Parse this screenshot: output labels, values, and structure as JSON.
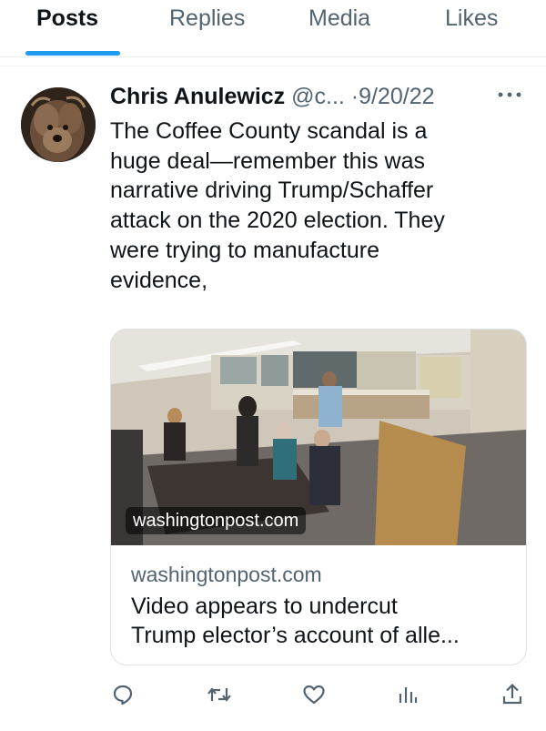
{
  "tabs": [
    {
      "label": "Posts",
      "active": true
    },
    {
      "label": "Replies",
      "active": false
    },
    {
      "label": "Media",
      "active": false
    },
    {
      "label": "Likes",
      "active": false
    }
  ],
  "post": {
    "author_name": "Chris Anulewicz",
    "author_handle": "@c...",
    "separator": "·",
    "date": "9/20/22",
    "text": "The Coffee County scandal is a\nhuge deal—remember this was\nnarrative driving Trump/Schaffer\nattack on the 2020 election.  They\nwere trying to manufacture\nevidence,",
    "card": {
      "image_overlay": "washingtonpost.com",
      "domain": "washingtonpost.com",
      "title": "Video appears to undercut\nTrump elector’s account of alle..."
    },
    "actions": [
      {
        "name": "reply",
        "icon": "reply-icon"
      },
      {
        "name": "repost",
        "icon": "repost-icon"
      },
      {
        "name": "like",
        "icon": "heart-icon"
      },
      {
        "name": "views",
        "icon": "views-icon"
      },
      {
        "name": "share",
        "icon": "share-icon"
      }
    ]
  },
  "colors": {
    "accent": "#1d9bf0",
    "text_primary": "#0f1419",
    "text_secondary": "#536471",
    "border": "#e6ecf0"
  }
}
